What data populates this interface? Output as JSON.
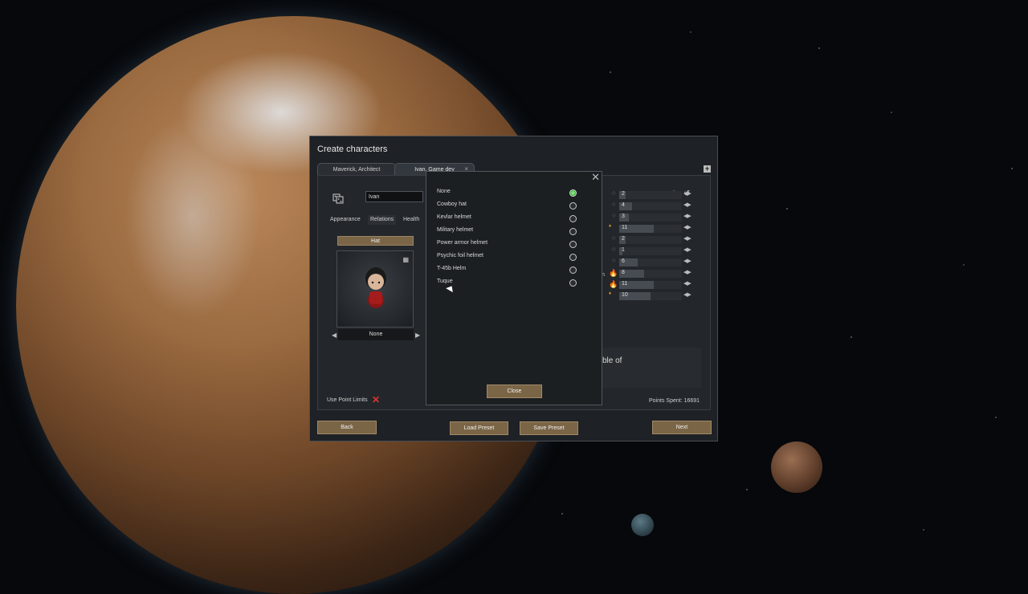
{
  "window": {
    "title": "Create characters"
  },
  "tabs": [
    {
      "label": "Maverick, Architect"
    },
    {
      "label": "Ivan, Game dev",
      "close": "×"
    }
  ],
  "add_icon": "+",
  "character": {
    "name": "Ivan",
    "subtabs": [
      "Appearance",
      "Relations",
      "Health"
    ],
    "hat_button": "Hat",
    "hat_value": "None",
    "arrow_left": "◀",
    "arrow_right": "▶"
  },
  "use_point_limits": {
    "label": "Use Point Limits",
    "mark": "✕"
  },
  "skills": {
    "values": [
      "2",
      "4",
      "3",
      "11",
      "2",
      "1",
      "6",
      "8",
      "11",
      "10"
    ],
    "levels": [
      2,
      4,
      3,
      11,
      2,
      1,
      6,
      8,
      11,
      10
    ],
    "passions": [
      "",
      "",
      "",
      "minor",
      "",
      "",
      "",
      "major",
      "major",
      "minor"
    ],
    "cutoff_label": "n",
    "arrows": "◀▶"
  },
  "description_fragment": "ble of",
  "points_spent": "Points Spent: 16691",
  "buttons": {
    "back": "Back",
    "load_preset": "Load Preset",
    "save_preset": "Save Preset",
    "next": "Next"
  },
  "hat_dialog": {
    "close_x": "✕",
    "options": [
      {
        "label": "None",
        "selected": true
      },
      {
        "label": "Cowboy hat",
        "selected": false
      },
      {
        "label": "Kevlar helmet",
        "selected": false
      },
      {
        "label": "Military helmet",
        "selected": false
      },
      {
        "label": "Power armor helmet",
        "selected": false
      },
      {
        "label": "Psychic foil helmet",
        "selected": false
      },
      {
        "label": "T-45b Helm",
        "selected": false
      },
      {
        "label": "Tuque",
        "selected": false
      }
    ],
    "close_button": "Close"
  },
  "colors": {
    "button": "#7a6546",
    "selected_radio": "#3a9a38",
    "passion": "#e6a21e",
    "no_limit": "#dd3333"
  }
}
